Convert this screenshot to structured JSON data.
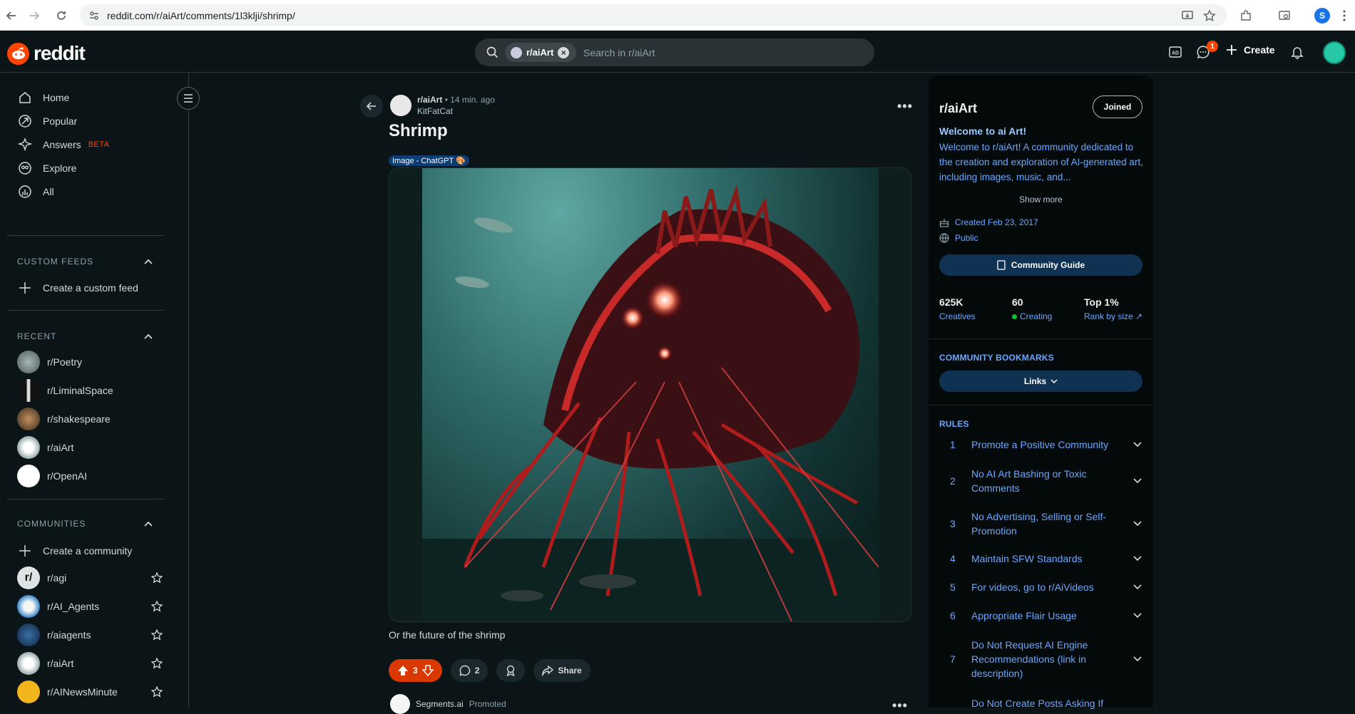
{
  "browser": {
    "url": "reddit.com/r/aiArt/comments/1l3klji/shrimp/",
    "profile_initial": "S"
  },
  "header": {
    "logo_text": "reddit",
    "search_chip": "r/aiArt",
    "search_placeholder": "Search in r/aiArt",
    "chat_badge": "1",
    "create_label": "Create"
  },
  "sidebar": {
    "nav": [
      {
        "label": "Home",
        "icon": "home-icon"
      },
      {
        "label": "Popular",
        "icon": "popular-icon"
      },
      {
        "label": "Answers",
        "icon": "answers-icon",
        "tag": "BETA"
      },
      {
        "label": "Explore",
        "icon": "explore-icon"
      },
      {
        "label": "All",
        "icon": "all-icon"
      }
    ],
    "custom_feeds_heading": "CUSTOM FEEDS",
    "create_feed_label": "Create a custom feed",
    "recent_heading": "RECENT",
    "recent": [
      "r/Poetry",
      "r/LiminalSpace",
      "r/shakespeare",
      "r/aiArt",
      "r/OpenAI"
    ],
    "communities_heading": "COMMUNITIES",
    "create_community_label": "Create a community",
    "communities": [
      "r/agi",
      "r/AI_Agents",
      "r/aiagents",
      "r/aiArt",
      "r/AINewsMinute"
    ]
  },
  "post": {
    "subreddit": "r/aiArt",
    "time": "14 min. ago",
    "author": "KitFatCat",
    "title": "Shrimp",
    "flair": "Image - ChatGPT",
    "caption": "Or the future of the shrimp",
    "votes": "3",
    "comments": "2",
    "share_label": "Share",
    "promo_name": "Segments.ai",
    "promo_tag": "Promoted"
  },
  "community": {
    "name": "r/aiArt",
    "joined_label": "Joined",
    "welcome": "Welcome to ai Art!",
    "description": "Welcome to r/aiArt! A community dedicated to the creation and exploration of AI-generated art, including images, music, and...",
    "show_more": "Show more",
    "created": "Created Feb 23, 2017",
    "visibility": "Public",
    "guide_label": "Community Guide",
    "stats": [
      {
        "value": "625K",
        "label": "Creatives"
      },
      {
        "value": "60",
        "label": "Creating"
      },
      {
        "value": "Top 1%",
        "label": "Rank by size"
      }
    ],
    "bookmarks_heading": "COMMUNITY BOOKMARKS",
    "links_label": "Links",
    "rules_heading": "RULES",
    "rules": [
      "Promote a Positive Community",
      "No AI Art Bashing or Toxic Comments",
      "No Advertising, Selling or Self-Promotion",
      "Maintain SFW Standards",
      "For videos, go to r/AiVideos",
      "Appropriate Flair Usage",
      "Do Not Request AI Engine Recommendations (link in description)",
      "Do Not Create Posts Asking If"
    ],
    "rule_numbers": [
      "1",
      "2",
      "3",
      "4",
      "5",
      "6",
      "7"
    ]
  },
  "colors": {
    "accent": "#ff4500",
    "link": "#6ba8ff",
    "vote_active": "#d93900"
  }
}
